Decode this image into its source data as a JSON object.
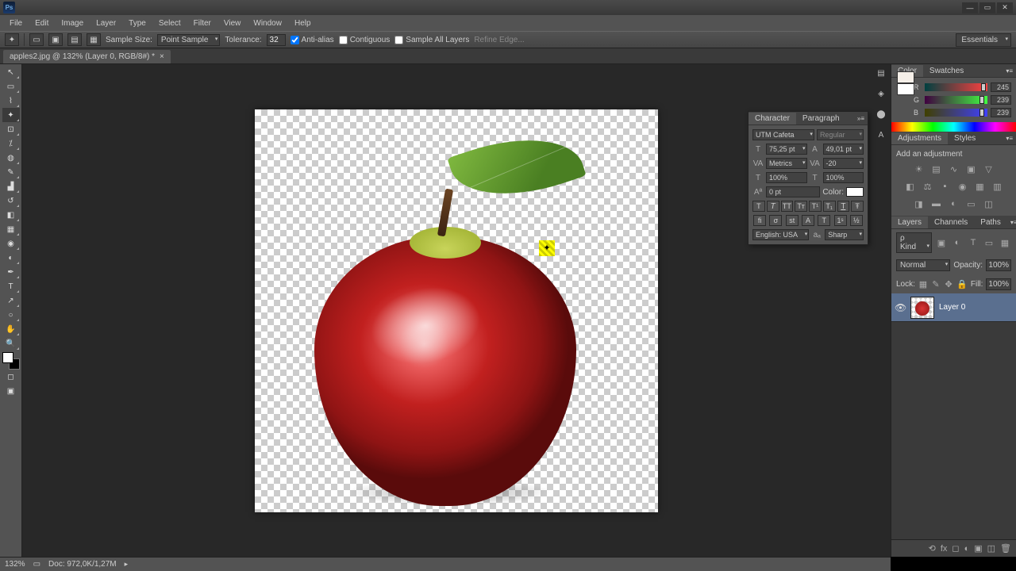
{
  "titlebar": {
    "logo": "Ps"
  },
  "window_controls": {
    "min": "—",
    "max": "▭",
    "close": "✕"
  },
  "menubar": [
    "File",
    "Edit",
    "Image",
    "Layer",
    "Type",
    "Select",
    "Filter",
    "View",
    "Window",
    "Help"
  ],
  "optionsbar": {
    "sample_size_label": "Sample Size:",
    "sample_size_value": "Point Sample",
    "tolerance_label": "Tolerance:",
    "tolerance_value": "32",
    "antialias": "Anti-alias",
    "contiguous": "Contiguous",
    "sample_all": "Sample All Layers",
    "refine_edge": "Refine Edge...",
    "workspace_switcher": "Essentials"
  },
  "document_tab": {
    "title": "apples2.jpg @ 132% (Layer 0, RGB/8#) *"
  },
  "tools": [
    {
      "name": "move-tool",
      "glyph": "↖"
    },
    {
      "name": "marquee-tool",
      "glyph": "▭"
    },
    {
      "name": "lasso-tool",
      "glyph": "⌇"
    },
    {
      "name": "magic-wand-tool",
      "glyph": "✦",
      "active": true
    },
    {
      "name": "crop-tool",
      "glyph": "⊡"
    },
    {
      "name": "eyedropper-tool",
      "glyph": "⁒"
    },
    {
      "name": "healing-brush-tool",
      "glyph": "◍"
    },
    {
      "name": "brush-tool",
      "glyph": "✎"
    },
    {
      "name": "clone-stamp-tool",
      "glyph": "▟"
    },
    {
      "name": "history-brush-tool",
      "glyph": "↺"
    },
    {
      "name": "eraser-tool",
      "glyph": "◧"
    },
    {
      "name": "gradient-tool",
      "glyph": "▦"
    },
    {
      "name": "blur-tool",
      "glyph": "◉"
    },
    {
      "name": "dodge-tool",
      "glyph": "◐"
    },
    {
      "name": "pen-tool",
      "glyph": "✒"
    },
    {
      "name": "type-tool",
      "glyph": "T"
    },
    {
      "name": "path-selection-tool",
      "glyph": "↗"
    },
    {
      "name": "shape-tool",
      "glyph": "○"
    },
    {
      "name": "hand-tool",
      "glyph": "✋"
    },
    {
      "name": "zoom-tool",
      "glyph": "🔍"
    }
  ],
  "color_panel": {
    "tabs": [
      "Color",
      "Swatches"
    ],
    "r": {
      "label": "R",
      "value": "245"
    },
    "g": {
      "label": "G",
      "value": "239"
    },
    "b": {
      "label": "B",
      "value": "239"
    }
  },
  "adjustments_panel": {
    "tabs": [
      "Adjustments",
      "Styles"
    ],
    "header": "Add an adjustment"
  },
  "layers_panel": {
    "tabs": [
      "Layers",
      "Channels",
      "Paths"
    ],
    "kind_label": "ρ Kind",
    "blend_mode": "Normal",
    "opacity_label": "Opacity:",
    "opacity_value": "100%",
    "lock_label": "Lock:",
    "fill_label": "Fill:",
    "fill_value": "100%",
    "layer0": {
      "name": "Layer 0"
    }
  },
  "character_panel": {
    "tabs": [
      "Character",
      "Paragraph"
    ],
    "font_family": "UTM Cafeta",
    "font_style": "Regular",
    "font_size": "75,25 pt",
    "leading": "49,01 pt",
    "kerning": "Metrics",
    "tracking": "-20",
    "vscale": "100%",
    "hscale": "100%",
    "baseline": "0 pt",
    "color_label": "Color:",
    "lang": "English: USA",
    "aa": "Sharp"
  },
  "statusbar": {
    "zoom": "132%",
    "doc_info": "Doc: 972,0K/1,27M"
  }
}
